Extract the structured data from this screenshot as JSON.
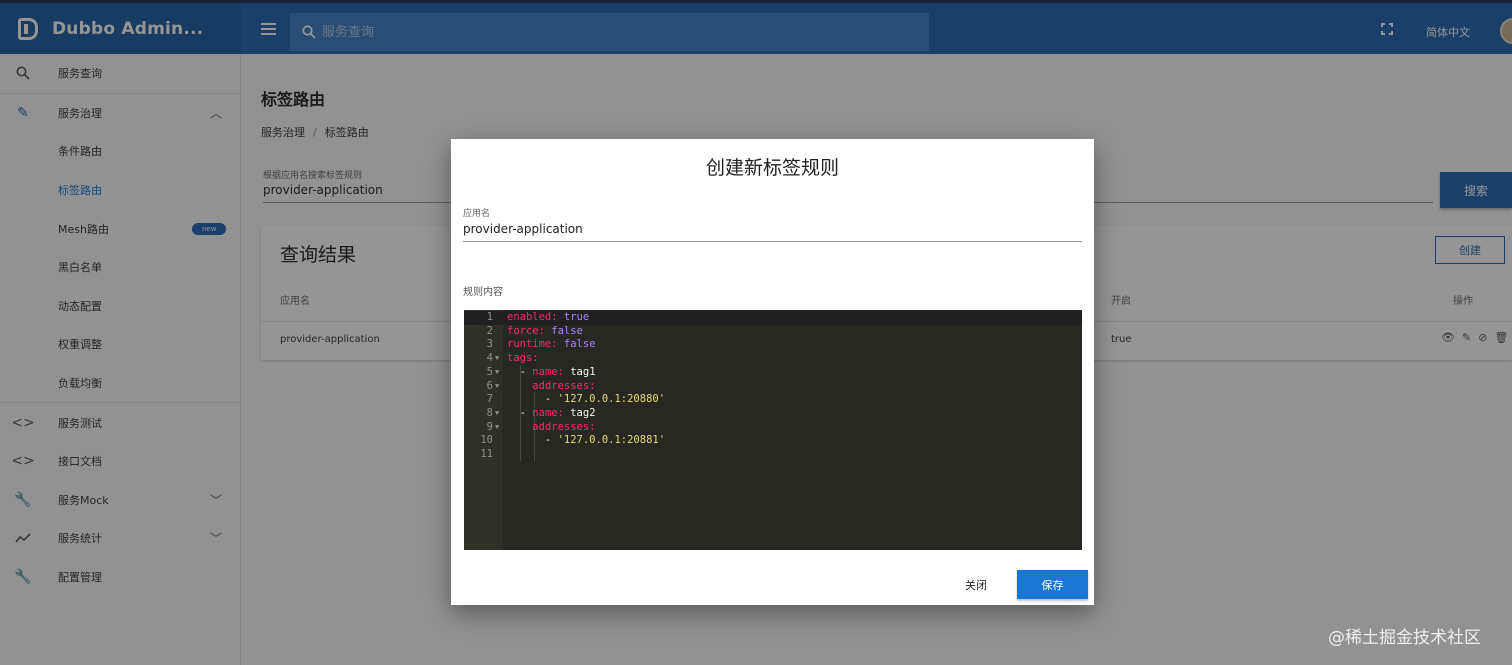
{
  "app": {
    "title": "Dubbo Admin..."
  },
  "header": {
    "search_placeholder": "服务查询",
    "language": "简体中文"
  },
  "sidebar": {
    "items": [
      {
        "label": "服务查询",
        "icon": "search-icon"
      },
      {
        "label": "服务治理",
        "icon": "pencil-icon",
        "expanded": true
      },
      {
        "label": "条件路由"
      },
      {
        "label": "标签路由",
        "active": true
      },
      {
        "label": "Mesh路由",
        "badge": "new"
      },
      {
        "label": "黑白名单"
      },
      {
        "label": "动态配置"
      },
      {
        "label": "权重调整"
      },
      {
        "label": "负载均衡"
      },
      {
        "label": "服务测试",
        "icon": "code-icon"
      },
      {
        "label": "接口文档",
        "icon": "code-icon"
      },
      {
        "label": "服务Mock",
        "icon": "wrench-icon",
        "expandable": true
      },
      {
        "label": "服务统计",
        "icon": "trending-up-icon",
        "expandable": true
      },
      {
        "label": "配置管理",
        "icon": "wrench-icon"
      }
    ]
  },
  "main": {
    "title": "标签路由",
    "breadcrumb": [
      "服务治理",
      "/",
      "标签路由"
    ],
    "search_label": "根据应用名搜索标签规则",
    "search_value": "provider-application",
    "search_button": "搜索",
    "results_title": "查询结果",
    "create_button": "创建",
    "table": {
      "headers": [
        "应用名",
        "开启",
        "操作"
      ],
      "rows": [
        {
          "app": "provider-application",
          "enabled": "true"
        }
      ]
    }
  },
  "dialog": {
    "title": "创建新标签规则",
    "app_label": "应用名",
    "app_value": "provider-application",
    "rule_label": "规则内容",
    "code_lines": [
      "enabled: true",
      "force: false",
      "runtime: false",
      "tags:",
      "  - name: tag1",
      "    addresses:",
      "      - '127.0.0.1:20880'",
      "  - name: tag2",
      "    addresses:",
      "      - '127.0.0.1:20881'",
      ""
    ],
    "close_button": "关闭",
    "save_button": "保存"
  },
  "watermark": "@稀土掘金技术社区",
  "colors": {
    "primary": "#1f65b0",
    "editor_bg": "#272822",
    "keyword": "#f92672",
    "boolean": "#ae81ff",
    "string": "#e6db74"
  }
}
